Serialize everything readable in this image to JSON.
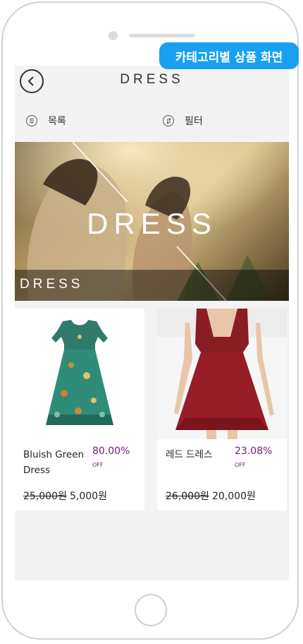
{
  "caption": "카테고리별 상품 화면",
  "header": {
    "title": "DRESS"
  },
  "toolbar": {
    "list_label": "목록",
    "filter_label": "필터"
  },
  "banner": {
    "title": "DRESS",
    "caption": "DRESS"
  },
  "products": [
    {
      "name": "Bluish Green Dress",
      "discount": "80.00%",
      "off_label": "OFF",
      "original_price": "25,000원",
      "sale_price": "5,000원"
    },
    {
      "name": "레드 드레스",
      "discount": "23.08%",
      "off_label": "OFF",
      "original_price": "26,000원",
      "sale_price": "20,000원"
    }
  ],
  "colors": {
    "accent": "#6e1e74",
    "badge": "#1aa0f0",
    "background": "#f3f3f3"
  }
}
